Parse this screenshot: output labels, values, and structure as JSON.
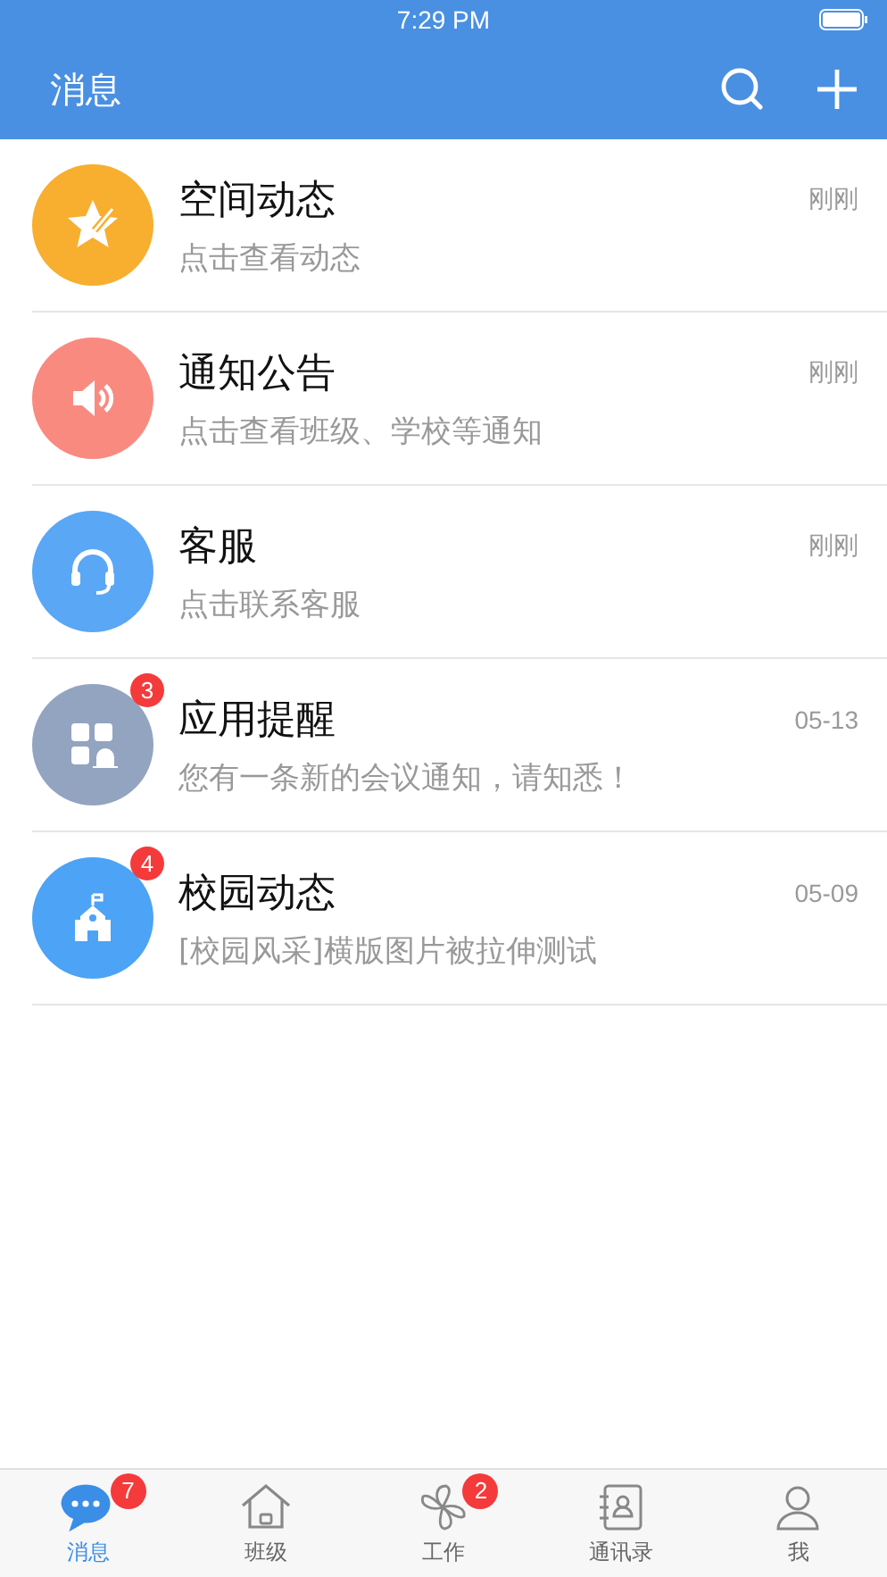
{
  "status_bar": {
    "time": "7:29 PM"
  },
  "header": {
    "title": "消息"
  },
  "messages": [
    {
      "kind": "star",
      "color": "#f8ae2f",
      "title": "空间动态",
      "subtitle": "点击查看动态",
      "time": "刚刚"
    },
    {
      "kind": "speaker",
      "color": "#f98a80",
      "title": "通知公告",
      "subtitle": "点击查看班级、学校等通知",
      "time": "刚刚"
    },
    {
      "kind": "headset",
      "color": "#5aa7f5",
      "title": "客服",
      "subtitle": "点击联系客服",
      "time": "刚刚"
    },
    {
      "kind": "apps",
      "color": "#93a4c0",
      "title": "应用提醒",
      "subtitle": "您有一条新的会议通知，请知悉！",
      "time": "05-13",
      "badge": "3"
    },
    {
      "kind": "school",
      "color": "#4da3f5",
      "title": "校园动态",
      "subtitle": "[校园风采]横版图片被拉伸测试",
      "time": "05-09",
      "badge": "4"
    }
  ],
  "tabs": [
    {
      "kind": "chat",
      "label": "消息",
      "selected": true,
      "badge": "7"
    },
    {
      "kind": "house",
      "label": "班级",
      "selected": false
    },
    {
      "kind": "fan",
      "label": "工作",
      "selected": false,
      "badge": "2"
    },
    {
      "kind": "contacts",
      "label": "通讯录",
      "selected": false
    },
    {
      "kind": "person",
      "label": "我",
      "selected": false
    }
  ]
}
